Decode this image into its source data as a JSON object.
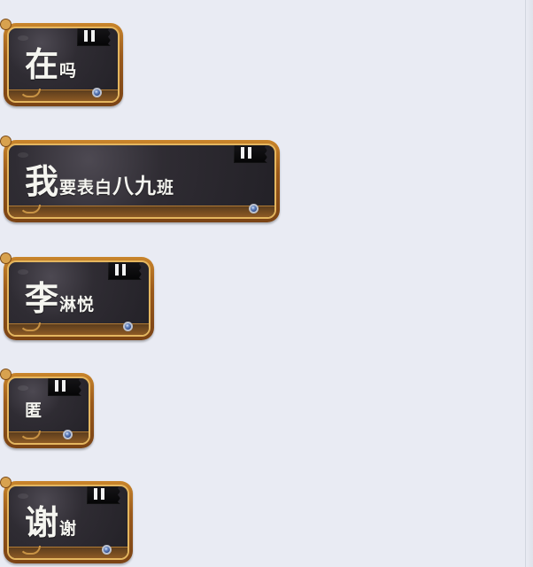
{
  "messages": [
    {
      "segments": [
        {
          "text": "在",
          "size": "big"
        },
        {
          "text": "吗",
          "size": "small"
        }
      ]
    },
    {
      "segments": [
        {
          "text": "我",
          "size": "big"
        },
        {
          "text": "要表白",
          "size": "small"
        },
        {
          "text": "八九",
          "size": "medium"
        },
        {
          "text": "班",
          "size": "small"
        }
      ]
    },
    {
      "segments": [
        {
          "text": "李",
          "size": "big"
        },
        {
          "text": "淋悦",
          "size": "small"
        }
      ]
    },
    {
      "segments": [
        {
          "text": "匿",
          "size": "small"
        }
      ]
    },
    {
      "segments": [
        {
          "text": "谢",
          "size": "big"
        },
        {
          "text": "谢",
          "size": "small"
        }
      ]
    }
  ]
}
